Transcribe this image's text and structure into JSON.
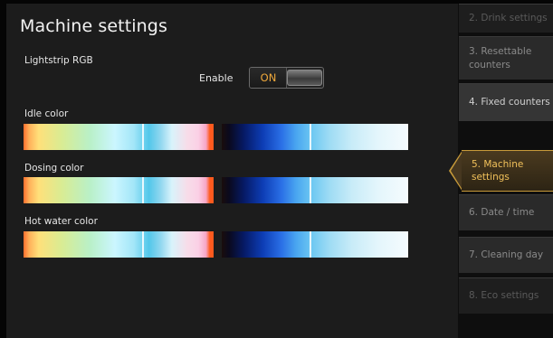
{
  "page": {
    "title": "Machine settings"
  },
  "lightstrip": {
    "section_label": "Lightstrip RGB",
    "enable_label": "Enable",
    "toggle_state": "ON"
  },
  "colors": [
    {
      "label": "Idle color"
    },
    {
      "label": "Dosing color"
    },
    {
      "label": "Hot water color"
    }
  ],
  "sidebar": {
    "items": [
      {
        "label": "2. Drink settings"
      },
      {
        "label": "3. Resettable counters"
      },
      {
        "label": "4. Fixed counters"
      },
      {
        "label": "5. Machine settings"
      },
      {
        "label": "6. Date / time"
      },
      {
        "label": "7. Cleaning day"
      },
      {
        "label": "8. Eco settings"
      }
    ],
    "active_index": 3
  },
  "theme": {
    "accent": "#f1c15a",
    "toggle_on": "#f0a93b"
  }
}
